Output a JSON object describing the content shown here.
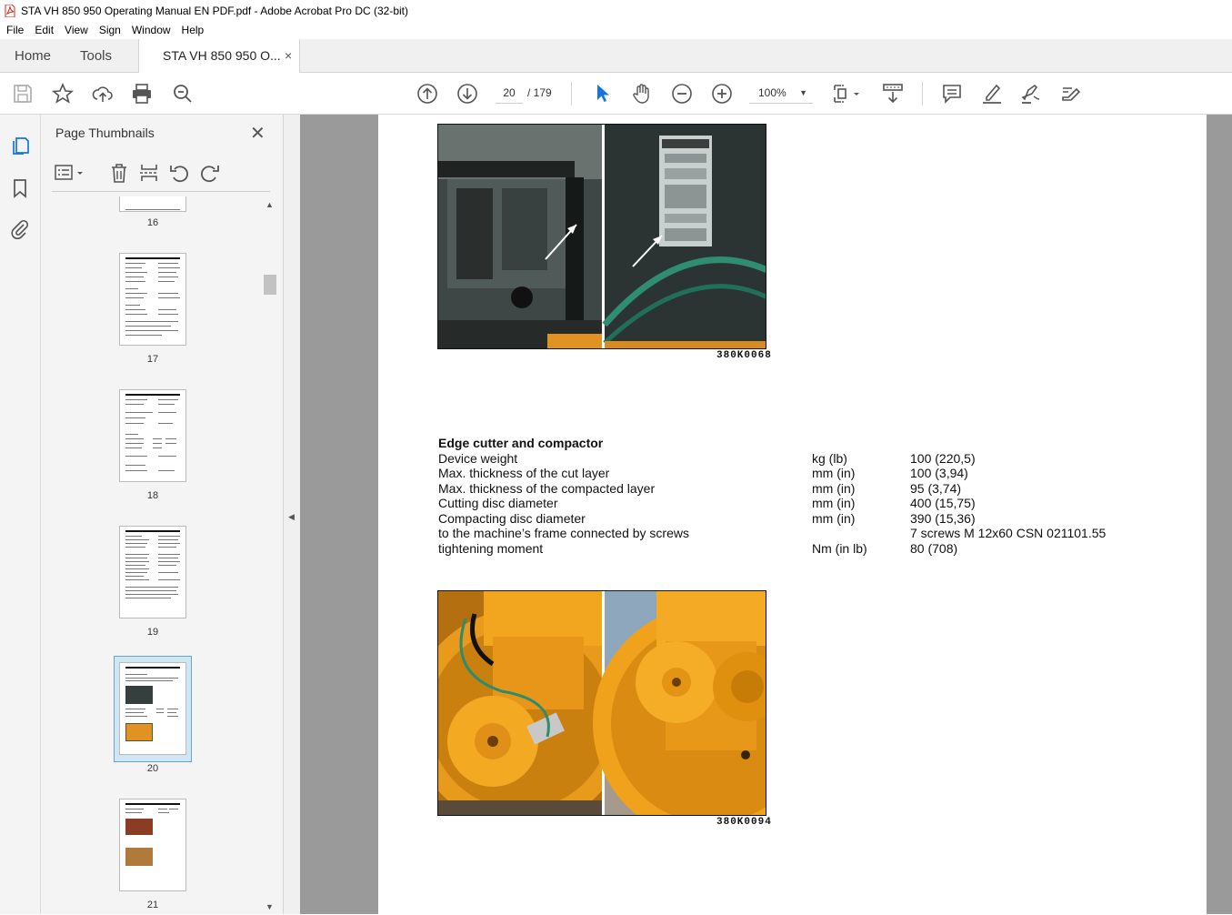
{
  "window": {
    "title": "STA VH 850 950 Operating Manual EN PDF.pdf - Adobe Acrobat Pro DC (32-bit)"
  },
  "menu": [
    "File",
    "Edit",
    "View",
    "Sign",
    "Window",
    "Help"
  ],
  "tabs": {
    "home": "Home",
    "tools": "Tools",
    "document": "STA VH 850 950 O...",
    "close": "×"
  },
  "toolbar": {
    "current_page": "20",
    "total_pages": "/ 179",
    "zoom": "100%"
  },
  "panel": {
    "title": "Page Thumbnails",
    "close": "✕",
    "thumbnails": [
      {
        "label": "16"
      },
      {
        "label": "17"
      },
      {
        "label": "18"
      },
      {
        "label": "19"
      },
      {
        "label": "20",
        "selected": true
      },
      {
        "label": "21"
      }
    ]
  },
  "document": {
    "figure1_caption": "380K0068",
    "figure2_caption": "380K0094",
    "section_title": "Edge cutter and compactor",
    "specs": [
      {
        "name": "Device weight",
        "unit": "kg (lb)",
        "value": "100  (220,5)"
      },
      {
        "name": "Max. thickness of the cut layer",
        "unit": "mm (in)",
        "value": "100  (3,94)"
      },
      {
        "name": "Max. thickness of the compacted layer",
        "unit": "mm (in)",
        "value": "95  (3,74)"
      },
      {
        "name": "Cutting disc diameter",
        "unit": "mm (in)",
        "value": "400  (15,75)"
      },
      {
        "name": "Compacting disc diameter",
        "unit": "mm (in)",
        "value": "390  (15,36)"
      },
      {
        "name": "to the machine’s frame connected by screws",
        "unit": "",
        "value": "7 screws M 12x60 CSN 021101.55"
      },
      {
        "name": "tightening moment",
        "unit": "Nm (in lb)",
        "value": "80  (708)"
      }
    ]
  },
  "colors": {
    "accent_blue": "#1473e6",
    "acrobat_red": "#d7261e",
    "machine_orange": "#f0a21c"
  }
}
